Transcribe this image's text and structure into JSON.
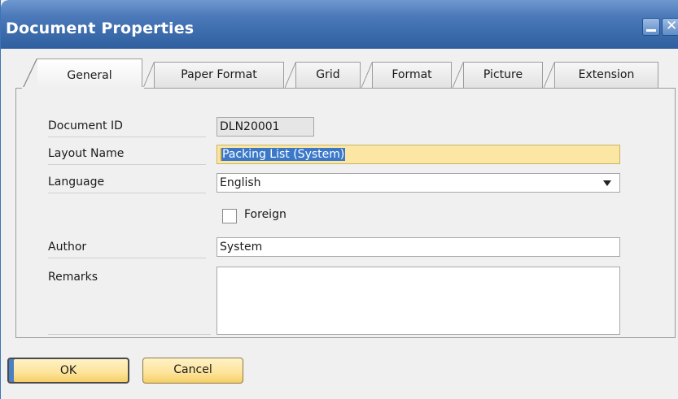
{
  "window": {
    "title": "Document Properties",
    "colors": {
      "titlebar": "#3e6cad",
      "highlight_field": "#fbe7a3",
      "selection": "#3b78c8",
      "button": "#fde39a"
    }
  },
  "titlebar_buttons": {
    "minimize_icon": "minimize-icon",
    "close_icon": "close-icon",
    "close_glyph": "✕"
  },
  "tabs": [
    {
      "label": "General",
      "active": true
    },
    {
      "label": "Paper Format",
      "active": false
    },
    {
      "label": "Grid",
      "active": false
    },
    {
      "label": "Format",
      "active": false
    },
    {
      "label": "Picture",
      "active": false
    },
    {
      "label": "Extension",
      "active": false
    }
  ],
  "form": {
    "document_id": {
      "label": "Document ID",
      "value": "DLN20001"
    },
    "layout_name": {
      "label": "Layout Name",
      "value": "Packing List (System)"
    },
    "language": {
      "label": "Language",
      "value": "English"
    },
    "foreign": {
      "label": "Foreign",
      "checked": false
    },
    "author": {
      "label": "Author",
      "value": "System"
    },
    "remarks": {
      "label": "Remarks",
      "value": ""
    }
  },
  "buttons": {
    "ok": "OK",
    "cancel": "Cancel"
  }
}
